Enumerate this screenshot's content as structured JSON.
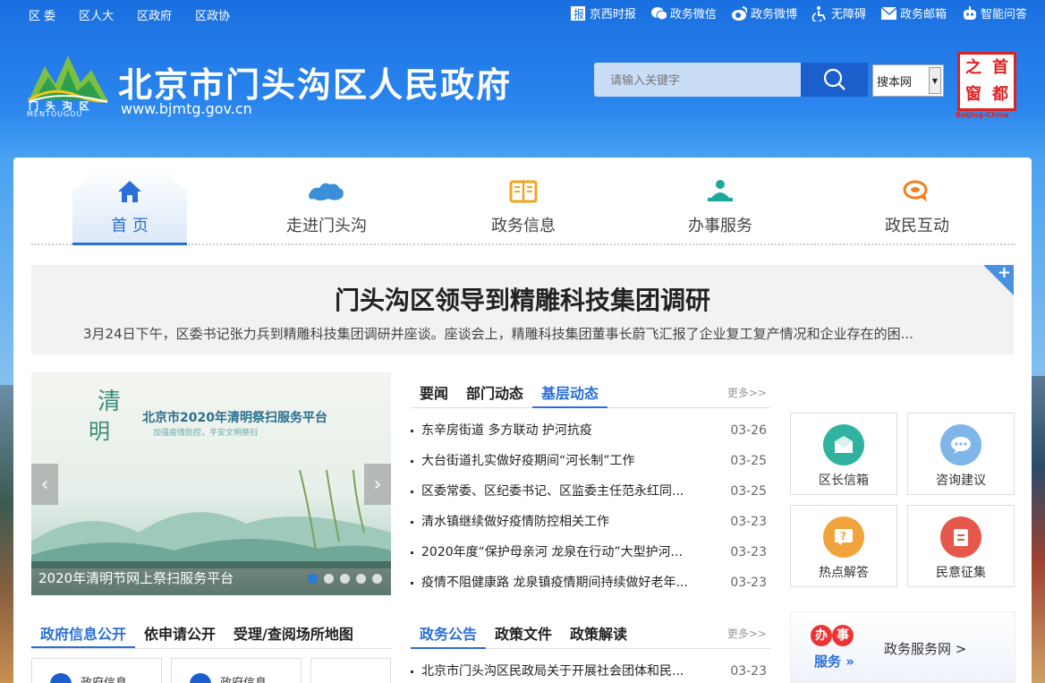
{
  "topbar": {
    "left_links": [
      "区 委",
      "区人大",
      "区政府",
      "区政协"
    ],
    "right_links": [
      {
        "label": "京西时报",
        "icon": "newspaper-icon"
      },
      {
        "label": "政务微信",
        "icon": "wechat-icon"
      },
      {
        "label": "政务微博",
        "icon": "weibo-icon"
      },
      {
        "label": "无障碍",
        "icon": "accessibility-icon"
      },
      {
        "label": "政务邮箱",
        "icon": "mail-icon"
      },
      {
        "label": "智能问答",
        "icon": "robot-icon"
      }
    ]
  },
  "header": {
    "logo_name": "门 头 沟 区",
    "logo_en": "MENTOUGOU",
    "site_title": "北京市门头沟区人民政府",
    "site_url": "www.bjmtg.gov.cn",
    "search_placeholder": "请输入关键字",
    "search_scope": "搜本网",
    "seal_chars": [
      "首",
      "之",
      "都",
      "窗"
    ],
    "seal_sub": "Beijing·China"
  },
  "nav": {
    "items": [
      {
        "label": "首 页",
        "icon": "home-icon",
        "active": true
      },
      {
        "label": "走进门头沟",
        "icon": "map-icon",
        "active": false
      },
      {
        "label": "政务信息",
        "icon": "book-icon",
        "active": false
      },
      {
        "label": "办事服务",
        "icon": "service-person-icon",
        "active": false
      },
      {
        "label": "政民互动",
        "icon": "chat-icon",
        "active": false
      }
    ]
  },
  "headline": {
    "title": "门头沟区领导到精雕科技集团调研",
    "summary": "3月24日下午，区委书记张力兵到精雕科技集团调研并座谈。座谈会上，精雕科技集团董事长蔚飞汇报了企业复工复产情况和企业存在的困..."
  },
  "carousel": {
    "image_qing": "清",
    "image_ming": "明",
    "image_title": "北京市2020年清明祭扫服务平台",
    "image_sub": "加强疫情防控，平安文明祭扫",
    "caption": "2020年清明节网上祭扫服务平台",
    "dots": 5,
    "active_dot": 0
  },
  "news": {
    "tabs": [
      "要闻",
      "部门动态",
      "基层动态"
    ],
    "active_tab": 2,
    "more": "更多>>",
    "items": [
      {
        "title": "东辛房街道 多方联动 护河抗疫",
        "date": "03-26"
      },
      {
        "title": "大台街道扎实做好疫期间“河长制”工作",
        "date": "03-25"
      },
      {
        "title": "区委常委、区纪委书记、区监委主任范永红同...",
        "date": "03-25"
      },
      {
        "title": "清水镇继续做好疫情防控相关工作",
        "date": "03-23"
      },
      {
        "title": "2020年度“保护母亲河 龙泉在行动”大型护河...",
        "date": "03-23"
      },
      {
        "title": "疫情不阻健康路 龙泉镇疫情期间持续做好老年...",
        "date": "03-23"
      }
    ]
  },
  "tiles": [
    {
      "label": "区长信箱",
      "icon": "mail-open-icon",
      "color": "#2fb3a0"
    },
    {
      "label": "咨询建议",
      "icon": "speech-bubble-icon",
      "color": "#7fb6ea"
    },
    {
      "label": "热点解答",
      "icon": "question-icon",
      "color": "#f0a53c"
    },
    {
      "label": "民意征集",
      "icon": "clipboard-icon",
      "color": "#e5584b"
    }
  ],
  "banner": {
    "ban": "办",
    "shi": "事",
    "fuwu": "服务 »",
    "link": "政务服务网 >"
  },
  "gov": {
    "tabs": [
      "政府信息公开",
      "依申请公开",
      "受理/查阅场所地图"
    ],
    "boxes": [
      "政府信息",
      "政府信息"
    ]
  },
  "announcements": {
    "tabs": [
      "政务公告",
      "政策文件",
      "政策解读"
    ],
    "more": "更多>>",
    "items": [
      {
        "title": "北京市门头沟区民政局关于开展社会团体和民...",
        "date": "03-23"
      }
    ]
  },
  "colors": {
    "primary": "#2a6fd6",
    "header_blue": "#1a6fe0",
    "search_btn": "#1a5fcc"
  }
}
